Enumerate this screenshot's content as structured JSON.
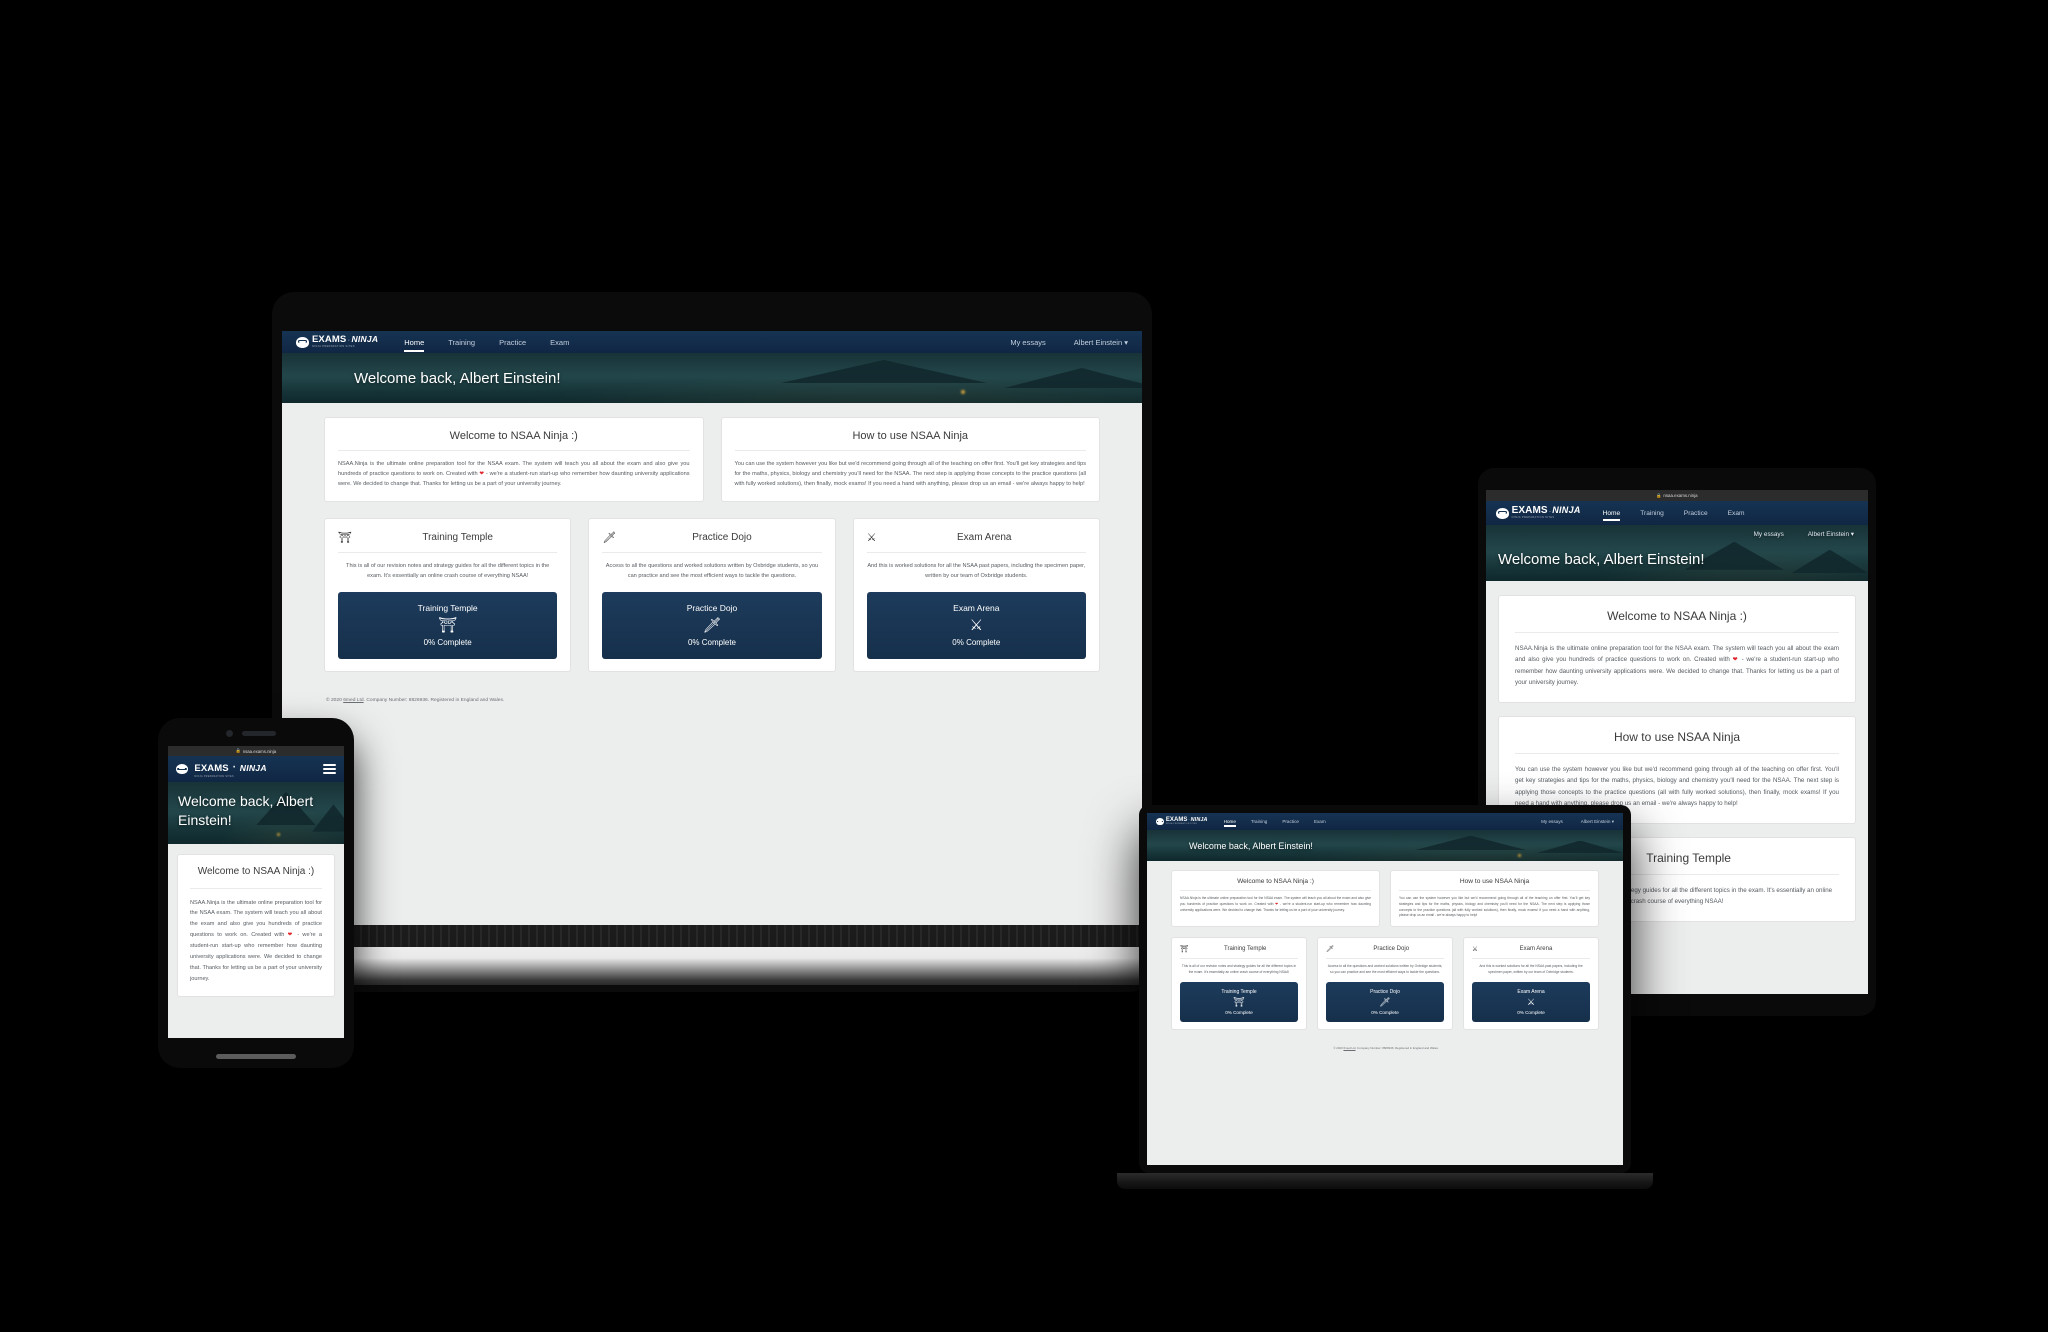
{
  "brand": {
    "mask_icon": "ninja-mask-icon",
    "name_primary": "EXAMS",
    "separator": "·",
    "name_secondary": "NINJA",
    "tagline": "NINJA PREPARATION SITES"
  },
  "browser": {
    "lock_icon": "lock-icon",
    "url": "nsaa.exams.ninja"
  },
  "nav": {
    "links": [
      {
        "label": "Home",
        "active": true
      },
      {
        "label": "Training",
        "active": false
      },
      {
        "label": "Practice",
        "active": false
      },
      {
        "label": "Exam",
        "active": false
      }
    ],
    "right": [
      {
        "label": "My essays"
      },
      {
        "label": "Albert Einstein ▾"
      }
    ],
    "menu_icon": "hamburger-menu-icon"
  },
  "hero": {
    "welcome": "Welcome back, Albert Einstein!"
  },
  "cards": {
    "welcome": {
      "title": "Welcome to NSAA Ninja :)",
      "body_before_heart": "NSAA.Ninja is the ultimate online preparation tool for the NSAA exam. The system will teach you all about the exam and also give you hundreds of practice questions to work on. Created with ",
      "heart": "❤",
      "body_after_heart": " - we're a student-run start-up who remember how daunting university applications were. We decided to change that. Thanks for letting us be a part of your university journey."
    },
    "howto": {
      "title": "How to use NSAA Ninja",
      "body": "You can use the system however you like but we'd recommend going through all of the teaching on offer first. You'll get key strategies and tips for the maths, physics, biology and chemistry you'll need for the NSAA. The next step is applying those concepts to the practice questions (all with fully worked solutions), then finally, mock exams! If you need a hand with anything, please drop us an email - we're always happy to help!"
    }
  },
  "features": [
    {
      "icon": "⛩",
      "icon_name": "torii-gate-icon",
      "title": "Training Temple",
      "body": "This is all of our revision notes and strategy guides for all the different topics in the exam. It's essentially an online crash course of everything NSAA!",
      "cta_label": "Training Temple",
      "cta_icon": "⛩",
      "cta_icon_name": "torii-gate-icon",
      "progress": "0% Complete"
    },
    {
      "icon": "🗡",
      "icon_name": "kunai-dagger-icon",
      "title": "Practice Dojo",
      "body": "Access to all the questions and worked solutions written by Oxbridge students, so you can practice and see the most efficient ways to tackle the questions.",
      "cta_label": "Practice Dojo",
      "cta_icon": "🗡",
      "cta_icon_name": "kunai-dagger-icon",
      "progress": "0% Complete"
    },
    {
      "icon": "⚔",
      "icon_name": "crossed-swords-icon",
      "title": "Exam Arena",
      "body": "And this is worked solutions for all the NSAA past papers, including the specimen paper, written by our team of Oxbridge students.",
      "cta_label": "Exam Arena",
      "cta_icon": "⚔",
      "cta_icon_name": "crossed-swords-icon",
      "progress": "0% Complete"
    }
  ],
  "footer": {
    "prefix": "© 2020 ",
    "company": "6med Ltd",
    "suffix": ". Company Number: 8826936. Registered in England and Wales."
  },
  "colors": {
    "navbar": "#142e4f",
    "cta": "#1d3b5c",
    "page_background": "#eceded",
    "card": "#ffffff",
    "heart": "#e0242b",
    "canvas": "#000000"
  }
}
